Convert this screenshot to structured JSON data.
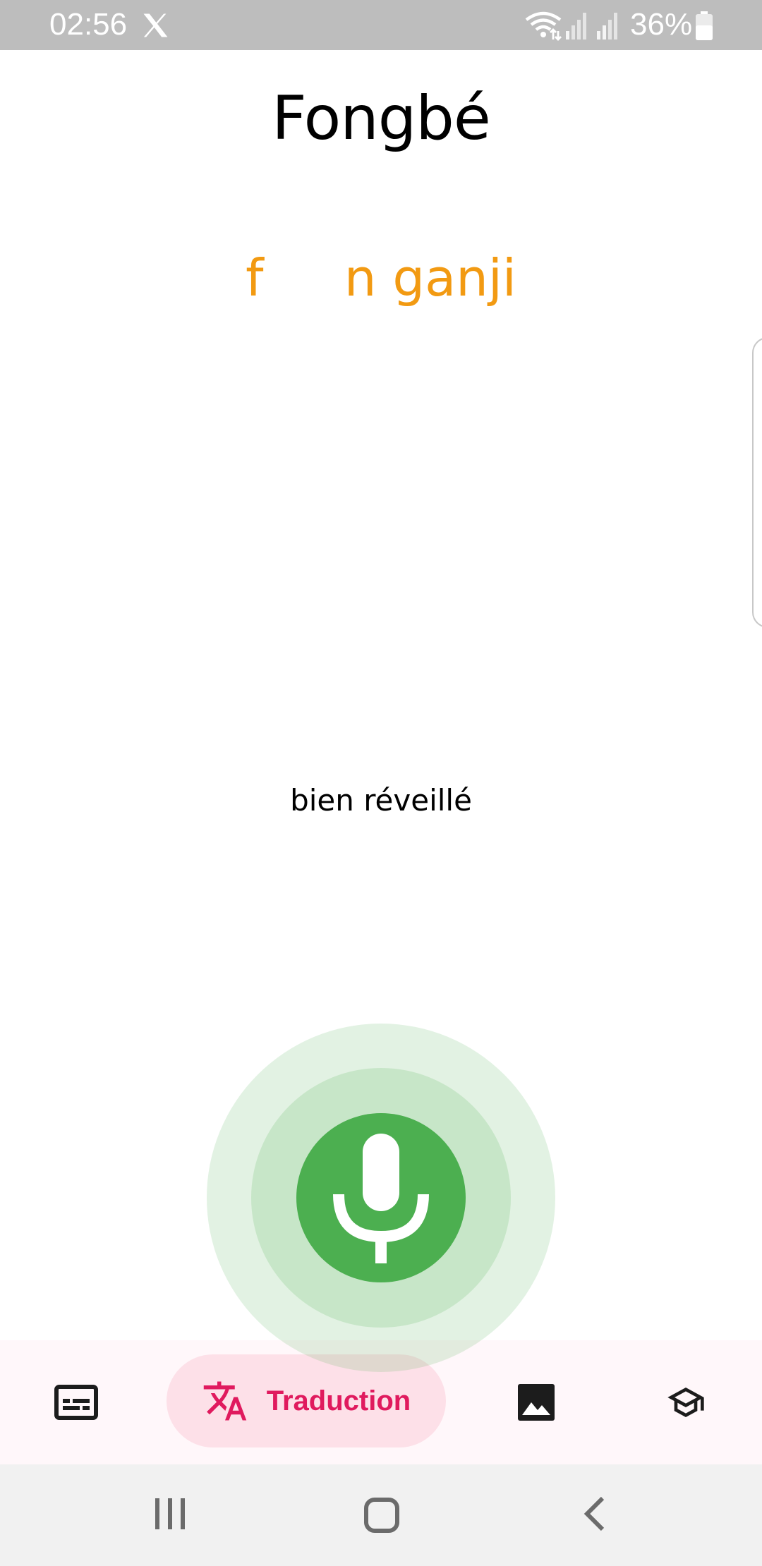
{
  "status_bar": {
    "time": "02:56",
    "battery": "36%",
    "icons": [
      "x-app-icon",
      "wifi-icon",
      "signal-icon",
      "signal-icon",
      "battery-icon"
    ]
  },
  "header": {
    "title": "Fongbé"
  },
  "content": {
    "fon_word": "f     n ganji",
    "french_translation": "bien réveillé"
  },
  "mic": {
    "icon": "microphone-icon",
    "color": "#4caf50"
  },
  "bottom_nav": {
    "items": [
      {
        "icon": "subtitles-icon",
        "label": ""
      },
      {
        "icon": "translate-icon",
        "label": "Traduction",
        "selected": true
      },
      {
        "icon": "image-icon",
        "label": ""
      },
      {
        "icon": "school-icon",
        "label": ""
      }
    ],
    "accent": "#e01a5e"
  },
  "system_nav": {
    "buttons": [
      "recents-icon",
      "home-icon",
      "back-icon"
    ]
  }
}
